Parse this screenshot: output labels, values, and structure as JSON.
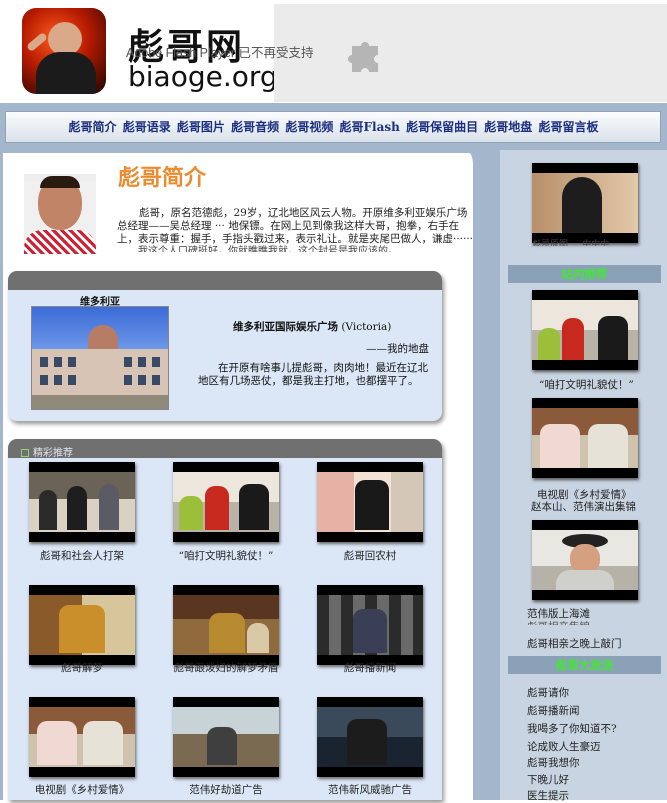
{
  "header": {
    "site_title": "彪哥网",
    "site_domain": "biaoge.org",
    "flash_notice": "Adobe Flash Player 已不再受支持"
  },
  "nav": {
    "items": [
      "彪哥简介",
      "彪哥语录",
      "彪哥图片",
      "彪哥音频",
      "彪哥视频",
      "彪哥Flash",
      "彪哥保留曲目",
      "彪哥地盘",
      "彪哥留言板"
    ]
  },
  "intro": {
    "title": "彪哥简介",
    "text": "彪哥，原名范德彪，29岁，辽北地区风云人物。开原维多利亚娱乐广场总经理——吴总经理 ··· 地保镖。在网上见到像我这样大哥，抱拳，右手在上，表示尊重：握手，手指头戳过来，表示礼让。就是夹尾巴做人，谦虚······",
    "text_cut": "我这个人口碑挺好，你就瞧瞧我就，这个封号是我应该的。"
  },
  "victoria": {
    "name": "维多利亚",
    "title": "维多利亚国际娱乐广场",
    "title_en": "(Victoria)",
    "signature": "——我的地盘",
    "text": "在开原有啥事儿提彪哥，肉肉地！最近在辽北地区有几场恶仗，都是我主打地，也都摆平了。"
  },
  "recommend": {
    "title": "精彩推荐",
    "items": [
      {
        "caption": "彪哥和社会人打架"
      },
      {
        "caption": "“咱打文明礼貌仗！”"
      },
      {
        "caption": "彪哥回农村"
      },
      {
        "caption": "彪哥解梦"
      },
      {
        "caption": "彪哥跟泼妇的解梦矛盾"
      },
      {
        "caption": "彪哥播新闻"
      },
      {
        "caption": "电视剧《乡村爱情》"
      },
      {
        "caption": "范伟好劫道广告"
      },
      {
        "caption": "范伟新风威驰广告"
      }
    ]
  },
  "sidebar": {
    "top_cut": "彪哥原图 ... 中中中",
    "section1": "站内推荐",
    "cap1": "“咱打文明礼貌仗！”",
    "cap2_line1": "电视剧《乡村爱情》",
    "cap2_line2": "赵本山、范伟演出集锦",
    "cap3_line1": "范伟版上海滩",
    "cap3_line2": "彪哥相亲集锦",
    "cap3_line3": "彪哥相亲之晚上敲门",
    "section2": "彪哥大放送",
    "links": [
      "彪哥请你",
      "彪哥播新闻",
      "我喝多了你知道不?",
      "论成败人生豪迈",
      "彪哥我想你",
      "下晚儿好",
      "医生提示"
    ]
  }
}
